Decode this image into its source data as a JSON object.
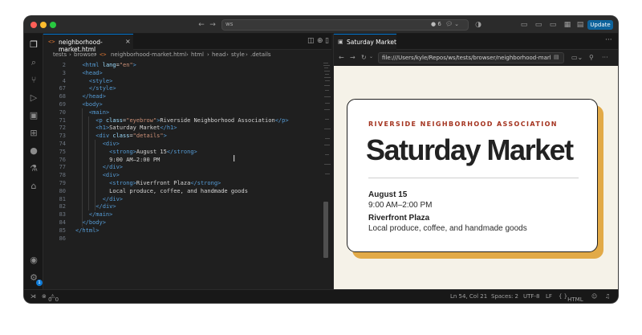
{
  "titlebar": {
    "search_text": "ws",
    "count": "6",
    "update_label": "Update"
  },
  "editor": {
    "tab_label": "neighborhood-market.html",
    "tab_icon": "<>",
    "breadcrumb": [
      "tests",
      "browser",
      "neighborhood-market.html",
      "html",
      "head",
      "style",
      ".details"
    ],
    "lines": [
      {
        "n": "2",
        "code": "  <html lang=\"en\">"
      },
      {
        "n": "3",
        "code": "  <head>"
      },
      {
        "n": "4",
        "code": "    <style>"
      },
      {
        "n": "67",
        "code": "    </style>"
      },
      {
        "n": "68",
        "code": "  </head>"
      },
      {
        "n": "69",
        "code": "  <body>"
      },
      {
        "n": "70",
        "code": "    <main>"
      },
      {
        "n": "71",
        "code": "      <p class=\"eyebrow\">Riverside Neighborhood Association</p>"
      },
      {
        "n": "72",
        "code": "      <h1>Saturday Market</h1>"
      },
      {
        "n": "73",
        "code": "      <div class=\"details\">"
      },
      {
        "n": "74",
        "code": "        <div>"
      },
      {
        "n": "75",
        "code": "          <strong>August 15</strong>"
      },
      {
        "n": "76",
        "code": "          9:00 AM–2:00 PM"
      },
      {
        "n": "77",
        "code": "        </div>"
      },
      {
        "n": "78",
        "code": "        <div>"
      },
      {
        "n": "79",
        "code": "          <strong>Riverfront Plaza</strong>"
      },
      {
        "n": "80",
        "code": "          Local produce, coffee, and handmade goods"
      },
      {
        "n": "81",
        "code": "        </div>"
      },
      {
        "n": "82",
        "code": "      </div>"
      },
      {
        "n": "83",
        "code": "    </main>"
      },
      {
        "n": "84",
        "code": "  </body>"
      },
      {
        "n": "85",
        "code": "</html>"
      },
      {
        "n": "86",
        "code": ""
      }
    ]
  },
  "browser": {
    "tab_label": "Saturday Market",
    "url": "file:///Users/kyle/Repos/ws/tests/browser/neighborhood-marke..."
  },
  "page": {
    "eyebrow": "RIVERSIDE NEIGHBORHOOD ASSOCIATION",
    "headline": "Saturday Market",
    "date": "August 15",
    "time": "9:00 AM–2:00 PM",
    "place": "Riverfront Plaza",
    "description": "Local produce, coffee, and handmade goods"
  },
  "status": {
    "errors": "0",
    "warnings": "0",
    "position": "Ln 54, Col 21",
    "spaces": "Spaces: 2",
    "encoding": "UTF-8",
    "eol": "LF",
    "language": "HTML"
  },
  "activity": {
    "badge": "1"
  },
  "colors": {
    "accent": "#0078d4",
    "eyebrow": "#a4331f",
    "card_shadow": "#e2aa48",
    "page_bg": "#f5f2e8"
  }
}
